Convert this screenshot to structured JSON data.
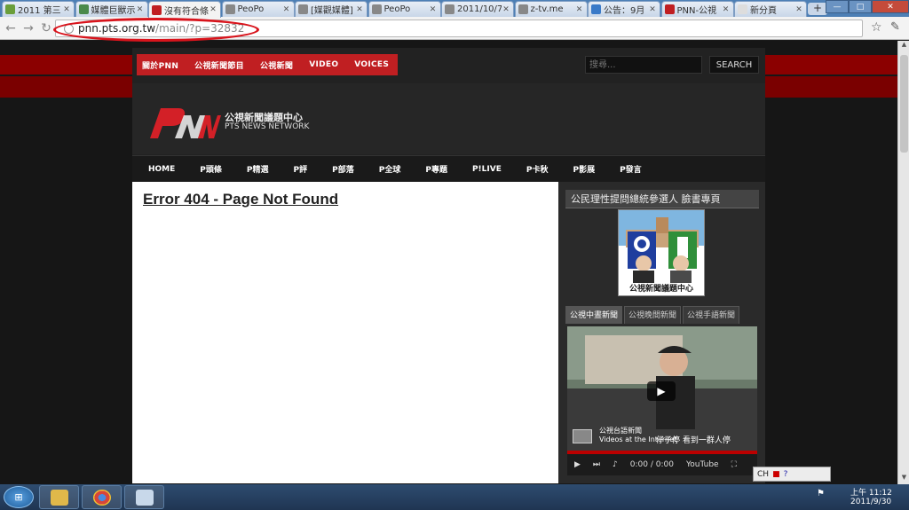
{
  "browser": {
    "tabs": [
      {
        "label": "2011 第三",
        "favicon_color": "#6a9e3a"
      },
      {
        "label": "媒體巨獸示",
        "favicon_color": "#4a8a4a"
      },
      {
        "label": "沒有符合條",
        "favicon_color": "#c01f22",
        "active": true
      },
      {
        "label": "PeoPo",
        "favicon_color": "#888888"
      },
      {
        "label": "[媒觀媒體]",
        "favicon_color": "#888888"
      },
      {
        "label": "PeoPo",
        "favicon_color": "#888888"
      },
      {
        "label": "2011/10/7",
        "favicon_color": "#888888"
      },
      {
        "label": "z-tv.me",
        "favicon_color": "#888888"
      },
      {
        "label": "公告：9月",
        "favicon_color": "#3a7ac8"
      },
      {
        "label": "PNN-公視",
        "favicon_color": "#c01f22"
      },
      {
        "label": "新分頁",
        "favicon_color": "#dddddd"
      }
    ],
    "url_host": "pnn.pts.org.tw",
    "url_path": "/main/?p=32832",
    "annotation_color": "#d8141c"
  },
  "site": {
    "top_menu": [
      "關於PNN",
      "公視新聞節目",
      "公視新聞",
      "VIDEO",
      "VOICES"
    ],
    "search": {
      "placeholder": "搜尋...",
      "button_label": "SEARCH"
    },
    "logo": {
      "mark": "PNN",
      "cn_name": "公視新聞議題中心",
      "en_name": "PTS NEWS NETWORK"
    },
    "main_nav": [
      "HOME",
      "P頭條",
      "P精選",
      "P評",
      "P部落",
      "P全球",
      "P專題",
      "P!LIVE",
      "P卡秋",
      "P影展",
      "P發言"
    ],
    "brand_red": "#c01f22"
  },
  "content": {
    "error_title": "Error 404 - Page Not Found"
  },
  "sidebar": {
    "heading": "公民理性提問總統參選人 臉書專頁",
    "banner_caption": "公視新聞議題中心",
    "video_tabs": [
      "公視中晝新聞",
      "公視晚間新聞",
      "公視手語新聞"
    ],
    "video": {
      "channel": "公視台語新聞",
      "channel_sub": "Videos at the Internet",
      "subtitle": "仔子停 看到一群人停",
      "time": "0:00 / 0:00",
      "youtube_label": "YouTube"
    }
  },
  "taskbar": {
    "ime_label": "CH",
    "time": "上午 11:12",
    "date": "2011/9/30"
  }
}
